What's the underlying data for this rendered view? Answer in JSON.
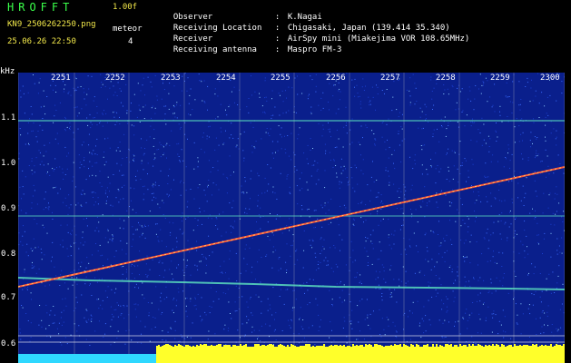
{
  "header": {
    "brand": "HROFFT",
    "version": "1.00f",
    "filename": "KN9_2506262250.png",
    "meteor_label": "meteor",
    "meteor_count": "4",
    "datetime": "25.06.26 22:50"
  },
  "info": [
    {
      "key": "Observer",
      "value": "K.Nagai"
    },
    {
      "key": "Receiving Location",
      "value": "Chigasaki, Japan (139.414 35.340)"
    },
    {
      "key": "Receiver",
      "value": "AirSpy mini (Miakejima VOR 108.65MHz)"
    },
    {
      "key": "Receiving antenna",
      "value": "Maspro FM-3"
    }
  ],
  "plot": {
    "y_unit": "kHz",
    "y_ticks": [
      "1.1",
      "1.0",
      "0.9",
      "0.8",
      "0.7",
      "0.6"
    ],
    "x_ticks": [
      "2251",
      "2252",
      "2253",
      "2254",
      "2255",
      "2256",
      "2257",
      "2258",
      "2259",
      "2300"
    ],
    "colors": {
      "background": "#0a1f8c",
      "meteor_trail": "#ff5a3c",
      "carrier": "#5fe8c0",
      "level_cyan": "#2fd8ff",
      "level_yellow": "#ffff2a",
      "grid": "#c8c8c8"
    }
  }
}
